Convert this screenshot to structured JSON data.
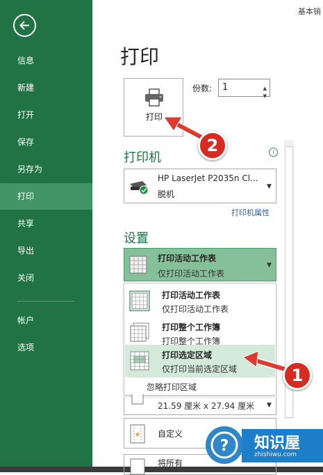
{
  "doc_title": "基本销",
  "sidebar": {
    "items": [
      {
        "label": "信息"
      },
      {
        "label": "新建"
      },
      {
        "label": "打开"
      },
      {
        "label": "保存"
      },
      {
        "label": "另存为"
      },
      {
        "label": "打印"
      },
      {
        "label": "共享"
      },
      {
        "label": "导出"
      },
      {
        "label": "关闭"
      },
      {
        "label": "帐户"
      },
      {
        "label": "选项"
      }
    ]
  },
  "main": {
    "title": "打印",
    "print_button": "打印",
    "copies_label": "份数:",
    "copies_value": "1",
    "printer_section": "打印机",
    "printer_name": "HP LaserJet P2035n Cl...",
    "printer_status": "脱机",
    "printer_properties": "打印机属性",
    "settings_section": "设置",
    "selected": {
      "title": "打印活动工作表",
      "desc": "仅打印活动工作表"
    },
    "options": [
      {
        "title": "打印活动工作表",
        "desc": "仅打印活动工作表"
      },
      {
        "title": "打印整个工作簿",
        "desc": "打印整个工作簿"
      },
      {
        "title": "打印选定区域",
        "desc": "仅打印当前选定区域"
      }
    ],
    "ignore_print_area": "忽略打印区域",
    "paper_size": "21.59 厘米 x 27.94 厘米",
    "margins": "自定义",
    "scaling": "将所有"
  },
  "annotations": {
    "step1": "1",
    "step2": "2"
  },
  "watermark": {
    "name": "知识屋",
    "url": "zhishiwu.com"
  },
  "colors": {
    "brand": "#217346",
    "active": "#439467",
    "highlight": "#d3eadb",
    "arrow": "#e03a2f"
  }
}
